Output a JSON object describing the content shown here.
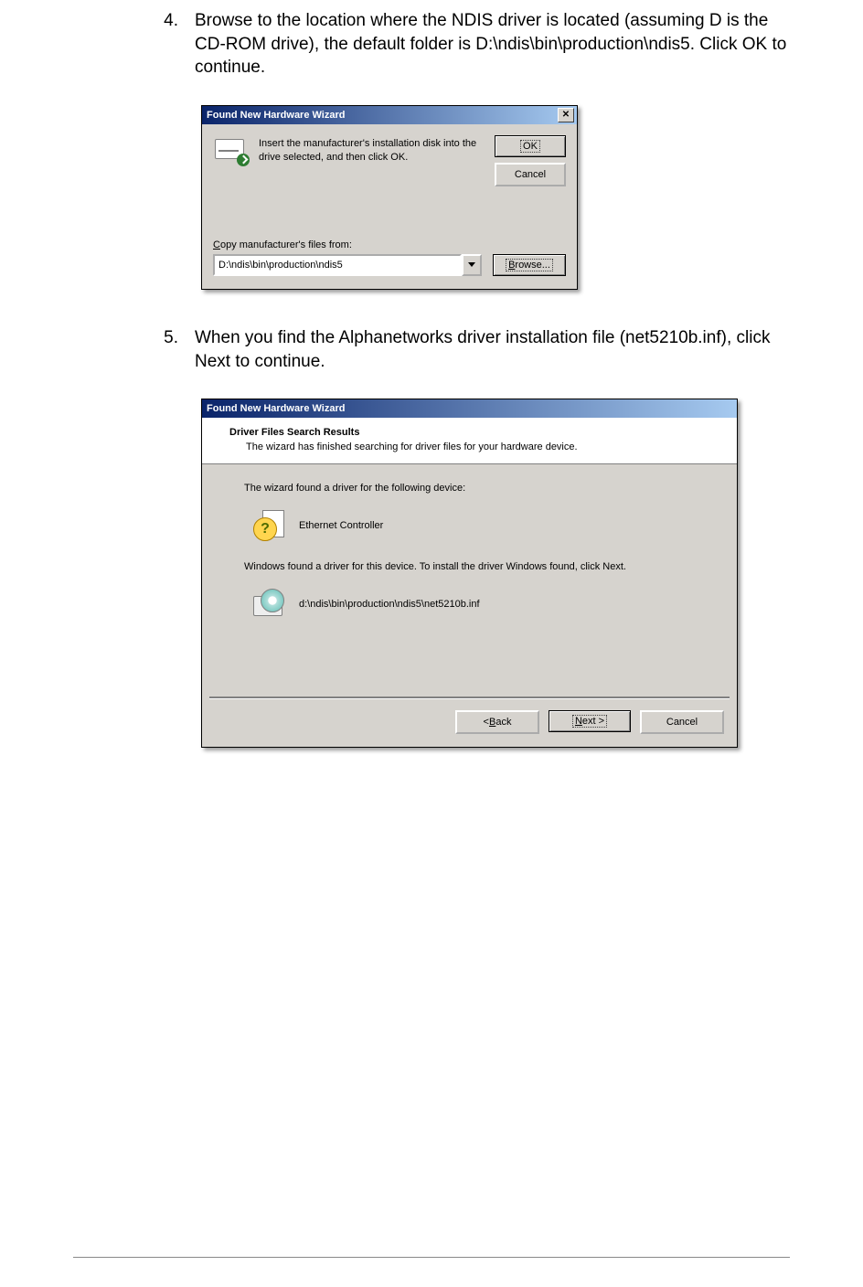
{
  "step4": {
    "num": "4.",
    "text": "Browse to the location where the NDIS driver is located (assuming D is the CD-ROM drive), the default folder is D:\\ndis\\bin\\production\\ndis5. Click OK to continue."
  },
  "step5": {
    "num": "5.",
    "text": "When you find the Alphanetworks driver installation file (net5210b.inf), click Next to continue."
  },
  "dlg1": {
    "title": "Found New Hardware Wizard",
    "msg": "Insert the manufacturer's installation disk into the drive selected, and then click OK.",
    "ok": "OK",
    "cancel": "Cancel",
    "copy_prefix": "C",
    "copy_rest": "opy manufacturer's files from:",
    "path": "D:\\ndis\\bin\\production\\ndis5",
    "browse_prefix": "B",
    "browse_rest": "rowse..."
  },
  "dlg2": {
    "title": "Found New Hardware Wizard",
    "h1": "Driver Files Search Results",
    "h2": "The wizard has finished searching for driver files for your hardware device.",
    "found_for": "The wizard found a driver for the following device:",
    "device": "Ethernet Controller",
    "found_msg": "Windows found a driver for this device. To install the driver Windows found, click Next.",
    "inf": "d:\\ndis\\bin\\production\\ndis5\\net5210b.inf",
    "back_prefix": "< ",
    "back_u": "B",
    "back_rest": "ack",
    "next_u": "N",
    "next_rest": "ext >",
    "cancel": "Cancel"
  }
}
